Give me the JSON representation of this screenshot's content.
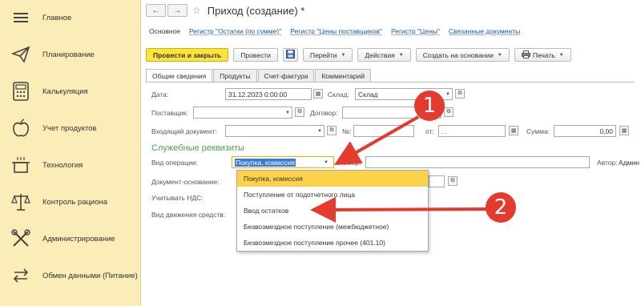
{
  "sidebar": {
    "items": [
      {
        "label": "Главное",
        "icon": "menu-icon"
      },
      {
        "label": "Планирование",
        "icon": "paper-plane-icon"
      },
      {
        "label": "Калькуляция",
        "icon": "calculator-icon"
      },
      {
        "label": "Учет продуктов",
        "icon": "apple-icon"
      },
      {
        "label": "Технология",
        "icon": "pot-icon"
      },
      {
        "label": "Контроль рациона",
        "icon": "scales-icon"
      },
      {
        "label": "Администрирование",
        "icon": "tools-icon"
      },
      {
        "label": "Обмен данными (Питание)",
        "icon": "exchange-icon"
      }
    ]
  },
  "header": {
    "back": "←",
    "forward": "→",
    "title": "Приход (создание) *",
    "star": "☆"
  },
  "links": [
    "Основное",
    "Регистр \"Остатки (по сумме)\"",
    "Регистр \"Цены поставщиков\"",
    "Регистр \"Цены\"",
    "Связанные документы"
  ],
  "toolbar": {
    "post_close": "Провести и закрыть",
    "post": "Провести",
    "go": "Перейти",
    "actions": "Действия",
    "create_based": "Создать на основании",
    "print": "Печать"
  },
  "tabs": [
    "Общие сведения",
    "Продукты",
    "Счет-фактура",
    "Комментарий"
  ],
  "form": {
    "date_label": "Дата:",
    "date_value": "31.12.2023  0:00:00",
    "warehouse_label": "Склад:",
    "warehouse_value": "Склад",
    "supplier_label": "Поставщик:",
    "contract_label": "Договор:",
    "incoming_doc_label": "Входящий документ:",
    "number_label": "№:",
    "from_label": "от:",
    "from_value": " .  .",
    "sum_label": "Сумма:",
    "sum_value": "0,00",
    "section_title": "Служебные реквизиты",
    "operation_label": "Вид операции:",
    "operation_value": "Покупка, комиссия",
    "number2_label": "Номер:",
    "author_label": "Автор:",
    "author_value": "Админ",
    "basis_label": "Документ-основание:",
    "vat_label": "Учитывать НДС:",
    "movement_label": "Вид движения средств:"
  },
  "dropdown_options": [
    "Покупка, комиссия",
    "Поступление от подотчетного лица",
    "Ввод остатков",
    "Безвозмездное поступление (межбюджетное)",
    "Безвозмездное поступление прочее (401.10)"
  ],
  "annotations": {
    "badge1": "1",
    "badge2": "2",
    "color": "#e53a2e"
  }
}
